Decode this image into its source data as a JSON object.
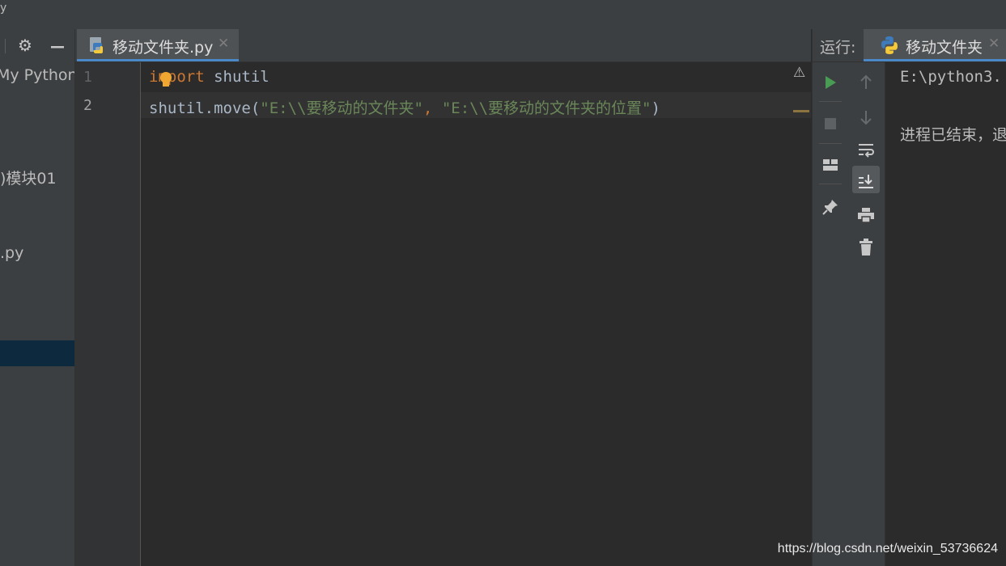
{
  "top_bar": {
    "glyph": "y"
  },
  "project_panel": {
    "tree_items": [
      {
        "label": "My Python"
      },
      {
        "label": ")模块01"
      },
      {
        "label": ".py"
      }
    ]
  },
  "editor": {
    "tab": {
      "label": "移动文件夹.py",
      "close": "✕"
    },
    "line_numbers": [
      "1",
      "2"
    ],
    "code": {
      "line1": {
        "keyword": "import",
        "rest": " shutil"
      },
      "line2": {
        "call": "shutil.move(",
        "arg1": "\"E:\\\\要移动的文件夹\"",
        "comma": ", ",
        "arg2": "\"E:\\\\要移动的文件夹的位置\"",
        "close_paren": ")"
      }
    }
  },
  "run_panel": {
    "title": "运行:",
    "tab": {
      "label": "移动文件夹",
      "close": "✕"
    },
    "console": [
      "E:\\python3.",
      "进程已结束，退"
    ]
  },
  "watermark": "https://blog.csdn.net/weixin_53736624",
  "colors": {
    "keyword": "#cc7832",
    "string": "#6a8759",
    "identifier": "#a9b7c6",
    "run_green": "#499c54",
    "selection": "#0d293e",
    "tab_underline": "#4a88c7"
  }
}
